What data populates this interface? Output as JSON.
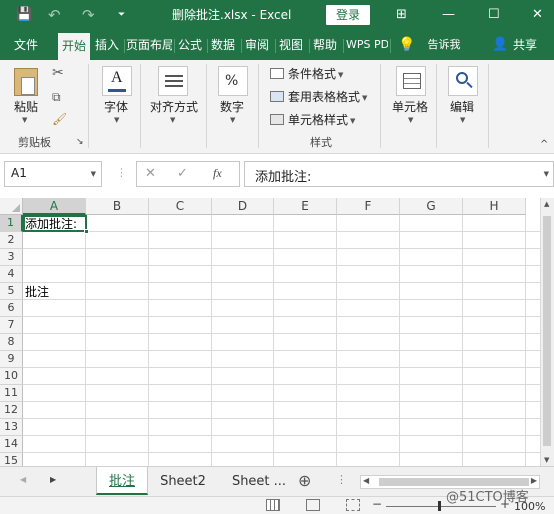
{
  "window": {
    "title": "删除批注.xlsx  -  Excel",
    "login_label": "登录",
    "qa_save": "💾",
    "qa_undo": "↶",
    "qa_redo": "↷",
    "qa_menu": "⏷",
    "minimize": "—",
    "maximize": "☐",
    "close": "✕",
    "display_options": "⊞"
  },
  "tabs": [
    {
      "label": "文件"
    },
    {
      "label": "开始"
    },
    {
      "label": "插入"
    },
    {
      "label": "页面布局"
    },
    {
      "label": "公式"
    },
    {
      "label": "数据"
    },
    {
      "label": "审阅"
    },
    {
      "label": "视图"
    },
    {
      "label": "帮助"
    },
    {
      "label": "WPS PDF"
    }
  ],
  "tell_me": {
    "icon": "lightbulb-icon",
    "label": "告诉我"
  },
  "share": {
    "icon": "person-icon",
    "label": "共享"
  },
  "ribbon": {
    "paste": "粘贴",
    "clipboard_group": "剪贴板",
    "font": "字体",
    "alignment": "对齐方式",
    "number": "数字",
    "number_symbol": "%",
    "conditional_format": "条件格式",
    "table_format": "套用表格格式",
    "cell_style": "单元格样式",
    "styles_group": "样式",
    "cells": "单元格",
    "editing": "编辑"
  },
  "formula_bar": {
    "name_box": "A1",
    "cancel": "✕",
    "enter": "✓",
    "fx": "fx",
    "content": "添加批注:"
  },
  "columns": [
    "A",
    "B",
    "C",
    "D",
    "E",
    "F",
    "G",
    "H"
  ],
  "rows": [
    "1",
    "2",
    "3",
    "4",
    "5",
    "6",
    "7",
    "8",
    "9",
    "10",
    "11",
    "12",
    "13",
    "14",
    "15"
  ],
  "cells": {
    "A1": "添加批注:",
    "A5": "批注"
  },
  "sheets": [
    {
      "label": "批注",
      "active": true
    },
    {
      "label": "Sheet2",
      "active": false
    },
    {
      "label": "Sheet ...",
      "active": false
    }
  ],
  "add_sheet": "⊕",
  "status": {
    "zoom": "100%"
  },
  "watermark": "@51CTO博客"
}
